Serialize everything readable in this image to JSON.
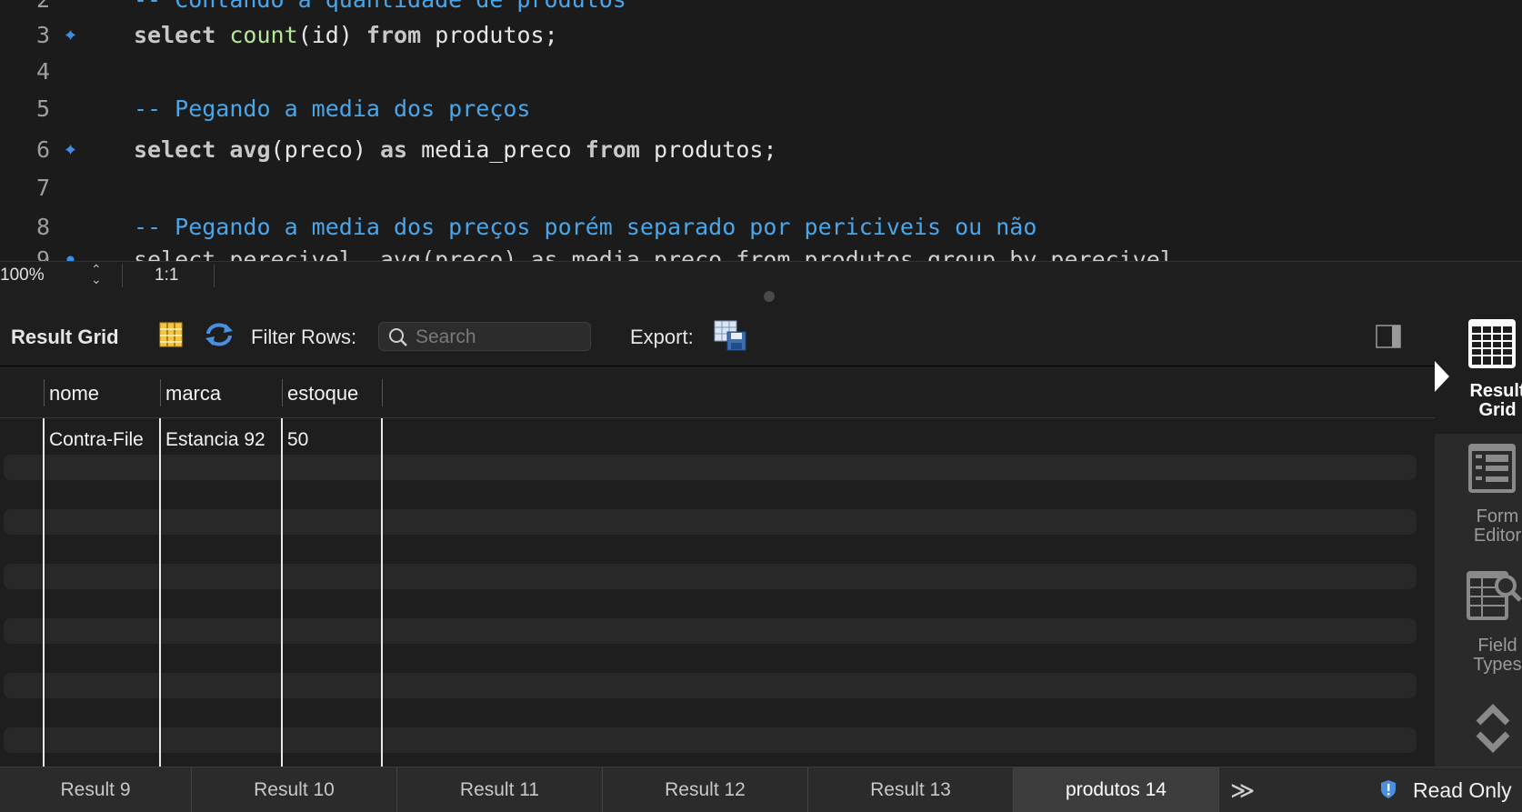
{
  "editor": {
    "lines": [
      {
        "num": "2",
        "marker": false,
        "comment": "-- Contando a quantidade de produtos"
      },
      {
        "num": "3",
        "marker": true,
        "kw1": "select",
        "fn": "count",
        "rest1": "(id)",
        "kw2": "from",
        "rest2": "produtos;"
      },
      {
        "num": "4",
        "marker": false
      },
      {
        "num": "5",
        "marker": false,
        "comment": "-- Pegando a media dos preços"
      },
      {
        "num": "6",
        "marker": true,
        "kw1": "select",
        "fn": "avg",
        "rest1": "(preco)",
        "kw2": "as",
        "rest2": "media_preco",
        "kw3": "from",
        "rest3": "produtos;"
      },
      {
        "num": "7",
        "marker": false
      },
      {
        "num": "8",
        "marker": false,
        "comment": "-- Pegando a media dos preços porém separado por periciveis ou não"
      },
      {
        "num": "9",
        "marker": true,
        "partial": "select perecivel, avg(preco) as media_preco from produtos group by perecivel"
      }
    ]
  },
  "zoombar": {
    "zoom": "100%",
    "ratio": "1:1"
  },
  "toolbar": {
    "title": "Result Grid",
    "filter_label": "Filter Rows:",
    "search_placeholder": "Search",
    "export_label": "Export:"
  },
  "grid": {
    "columns": [
      "nome",
      "marca",
      "estoque"
    ],
    "rows": [
      [
        "Contra-File",
        "Estancia 92",
        "50"
      ]
    ]
  },
  "side_panel": {
    "items": [
      {
        "label_line1": "Result",
        "label_line2": "Grid",
        "icon": "result-grid-icon",
        "active": true
      },
      {
        "label_line1": "Form",
        "label_line2": "Editor",
        "icon": "form-editor-icon",
        "active": false
      },
      {
        "label_line1": "Field",
        "label_line2": "Types",
        "icon": "field-types-icon",
        "active": false
      }
    ]
  },
  "tabs": [
    {
      "label": "Result 9",
      "active": false
    },
    {
      "label": "Result 10",
      "active": false
    },
    {
      "label": "Result 11",
      "active": false
    },
    {
      "label": "Result 12",
      "active": false
    },
    {
      "label": "Result 13",
      "active": false
    },
    {
      "label": "produtos 14",
      "active": true
    }
  ],
  "tabs_more": "≫",
  "status": {
    "read_only": "Read Only"
  },
  "colors": {
    "comment": "#4aa6ea",
    "function": "#b7e69a",
    "background": "#1e1e1e",
    "marker": "#3a8ee6"
  }
}
